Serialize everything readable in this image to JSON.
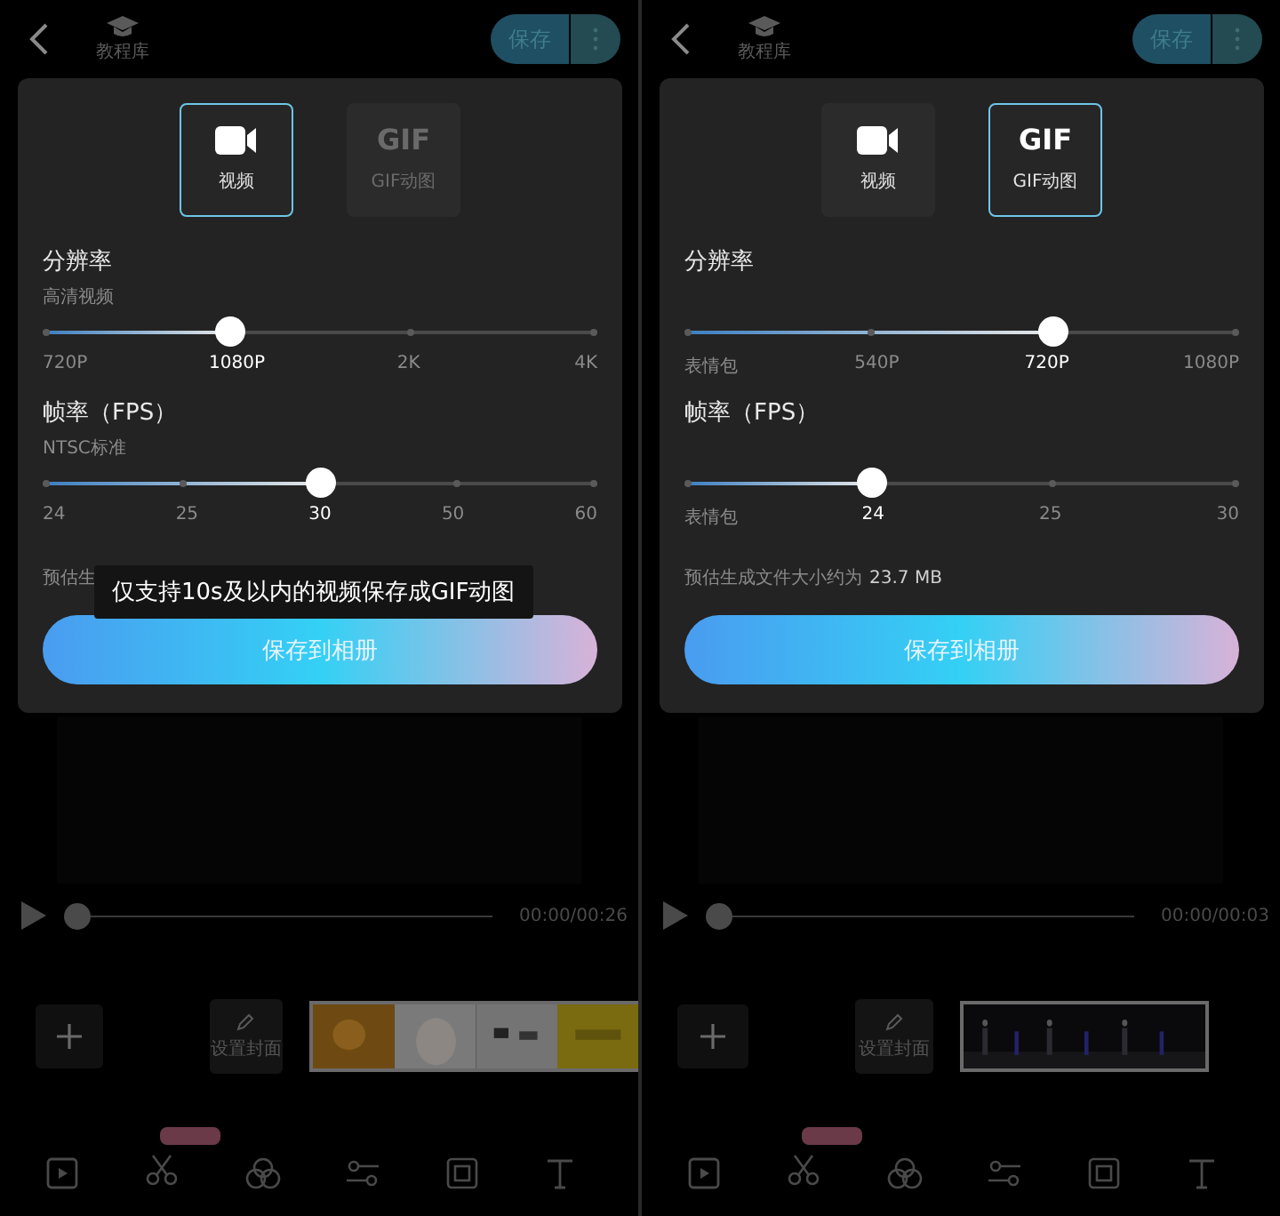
{
  "screens": [
    {
      "top_bar": {
        "tutorial_label": "教程库",
        "save_button": "保存"
      },
      "format_options": [
        {
          "kind": "video",
          "label": "视频",
          "selected": true,
          "disabled": false
        },
        {
          "kind": "gif",
          "glyph": "GIF",
          "label": "GIF动图",
          "selected": false,
          "disabled": true
        }
      ],
      "resolution": {
        "title": "分辨率",
        "subtitle": "高清视频",
        "level": 0.333,
        "ticks": [
          {
            "label": "720P",
            "selected": false
          },
          {
            "label": "1080P",
            "selected": true
          },
          {
            "label": "2K",
            "selected": false
          },
          {
            "label": "4K",
            "selected": false
          }
        ]
      },
      "frame_rate": {
        "title": "帧率（FPS）",
        "subtitle": "NTSC标准",
        "level": 0.5,
        "ticks": [
          {
            "label": "24",
            "selected": false
          },
          {
            "label": "25",
            "selected": false
          },
          {
            "label": "30",
            "selected": true
          },
          {
            "label": "50",
            "selected": false
          },
          {
            "label": "60",
            "selected": false
          }
        ]
      },
      "estimate": {
        "label": "预估生"
      },
      "toast": "仅支持10s及以内的视频保存成GIF动图",
      "save_album_button": "保存到相册",
      "player": {
        "time": "00:00/00:26"
      },
      "timeline": {
        "cover_label": "设置封面"
      }
    },
    {
      "top_bar": {
        "tutorial_label": "教程库",
        "save_button": "保存"
      },
      "format_options": [
        {
          "kind": "video",
          "label": "视频",
          "selected": false,
          "disabled": false
        },
        {
          "kind": "gif",
          "glyph": "GIF",
          "label": "GIF动图",
          "selected": true,
          "disabled": false
        }
      ],
      "resolution": {
        "title": "分辨率",
        "level": 0.667,
        "ticks": [
          {
            "label": "表情包",
            "selected": false
          },
          {
            "label": "540P",
            "selected": false
          },
          {
            "label": "720P",
            "selected": true
          },
          {
            "label": "1080P",
            "selected": false
          }
        ]
      },
      "frame_rate": {
        "title": "帧率（FPS）",
        "level": 0.333,
        "ticks": [
          {
            "label": "表情包",
            "selected": false
          },
          {
            "label": "24",
            "selected": true
          },
          {
            "label": "25",
            "selected": false
          },
          {
            "label": "30",
            "selected": false
          }
        ]
      },
      "estimate": {
        "label": "预估生成文件大小约为",
        "value": "23.7 MB"
      },
      "save_album_button": "保存到相册",
      "player": {
        "time": "00:00/00:03"
      },
      "timeline": {
        "cover_label": "设置封面"
      }
    }
  ]
}
